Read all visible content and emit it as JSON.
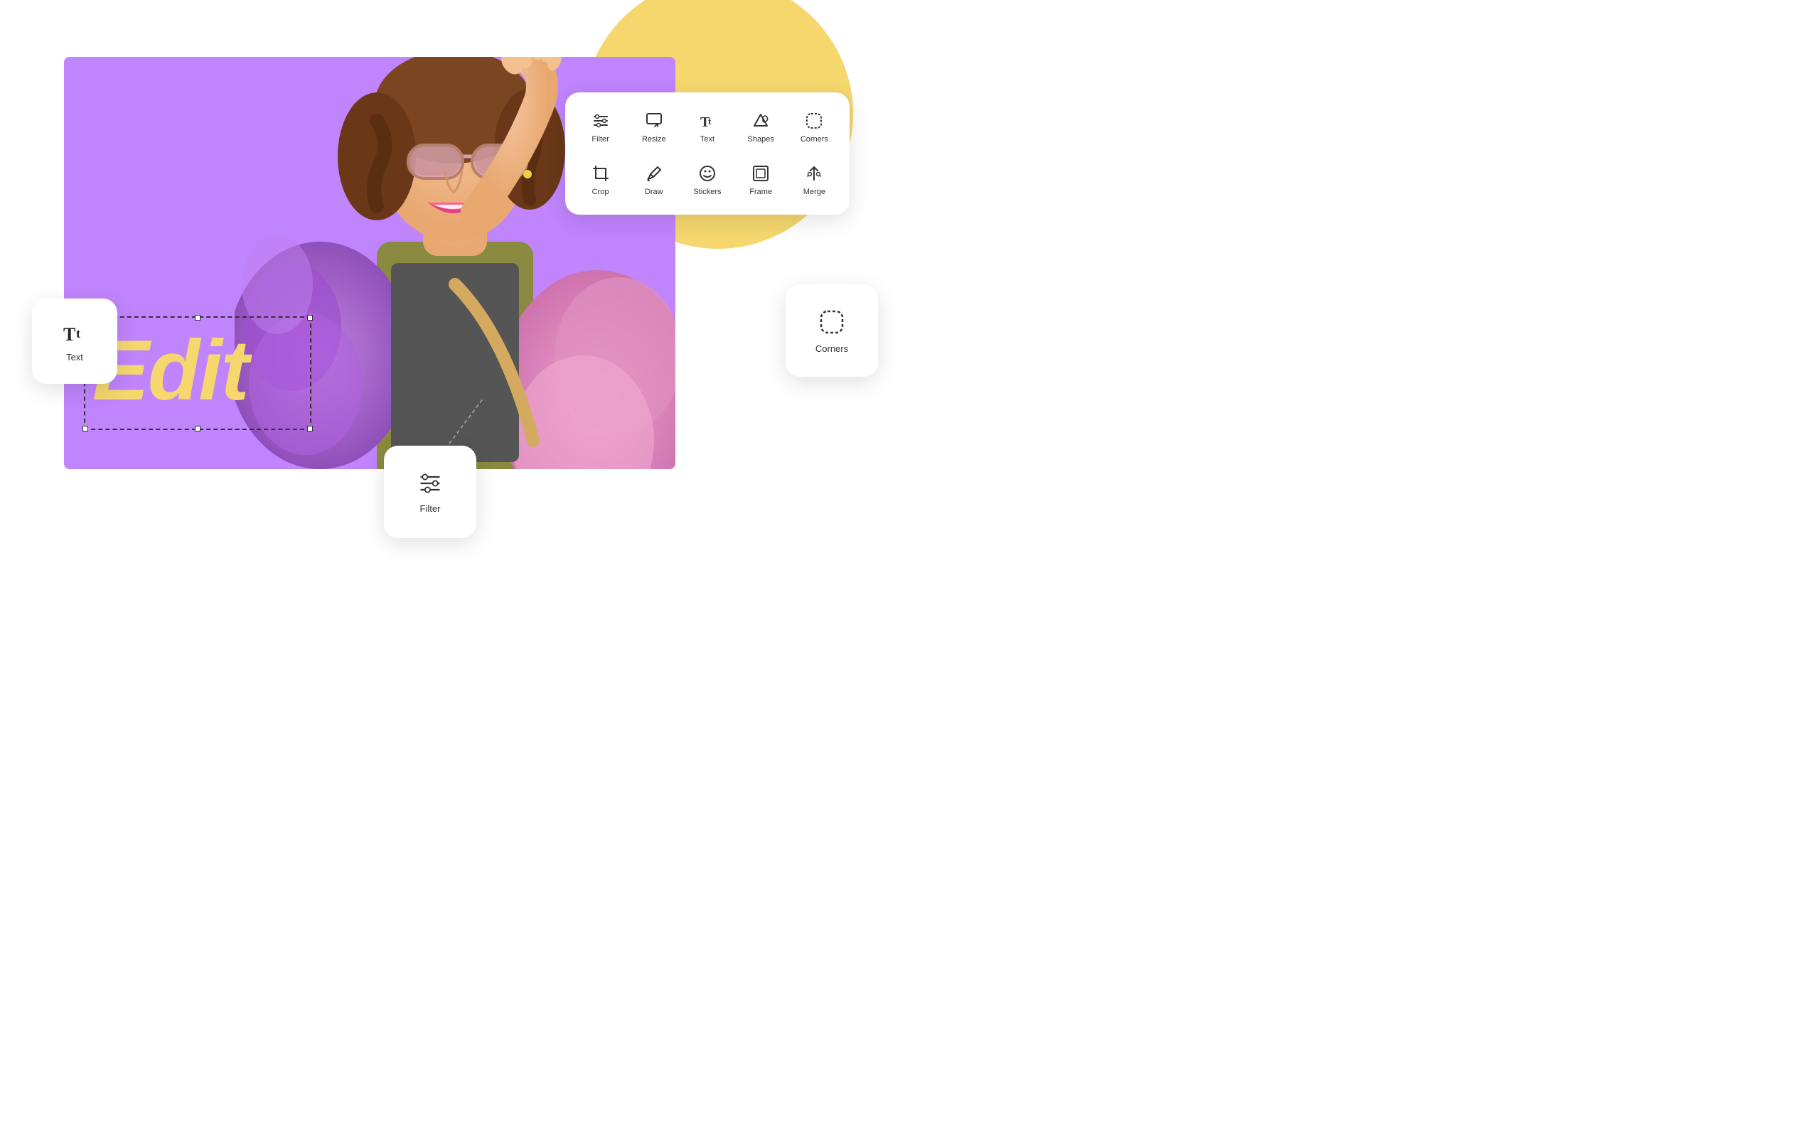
{
  "toolbar": {
    "items_row1": [
      {
        "id": "filter",
        "label": "Filter",
        "icon": "filter"
      },
      {
        "id": "resize",
        "label": "Resize",
        "icon": "resize"
      },
      {
        "id": "text",
        "label": "Text",
        "icon": "text"
      },
      {
        "id": "shapes",
        "label": "Shapes",
        "icon": "shapes"
      },
      {
        "id": "corners",
        "label": "Corners",
        "icon": "corners"
      }
    ],
    "items_row2": [
      {
        "id": "crop",
        "label": "Crop",
        "icon": "crop"
      },
      {
        "id": "draw",
        "label": "Draw",
        "icon": "draw"
      },
      {
        "id": "stickers",
        "label": "Stickers",
        "icon": "stickers"
      },
      {
        "id": "frame",
        "label": "Frame",
        "icon": "frame"
      },
      {
        "id": "merge",
        "label": "Merge",
        "icon": "merge"
      }
    ]
  },
  "floating_cards": {
    "text_card": {
      "label": "Text",
      "icon": "Tt"
    },
    "filter_card": {
      "label": "Filter",
      "icon": "filter"
    },
    "corners_card": {
      "label": "Corners",
      "icon": "corners"
    }
  },
  "canvas": {
    "edit_text": "Edit"
  },
  "colors": {
    "purple_bg": "#C084FC",
    "yellow_accent": "#F5D76E",
    "yellow_circle": "#F5D76E",
    "white_card": "#ffffff"
  }
}
